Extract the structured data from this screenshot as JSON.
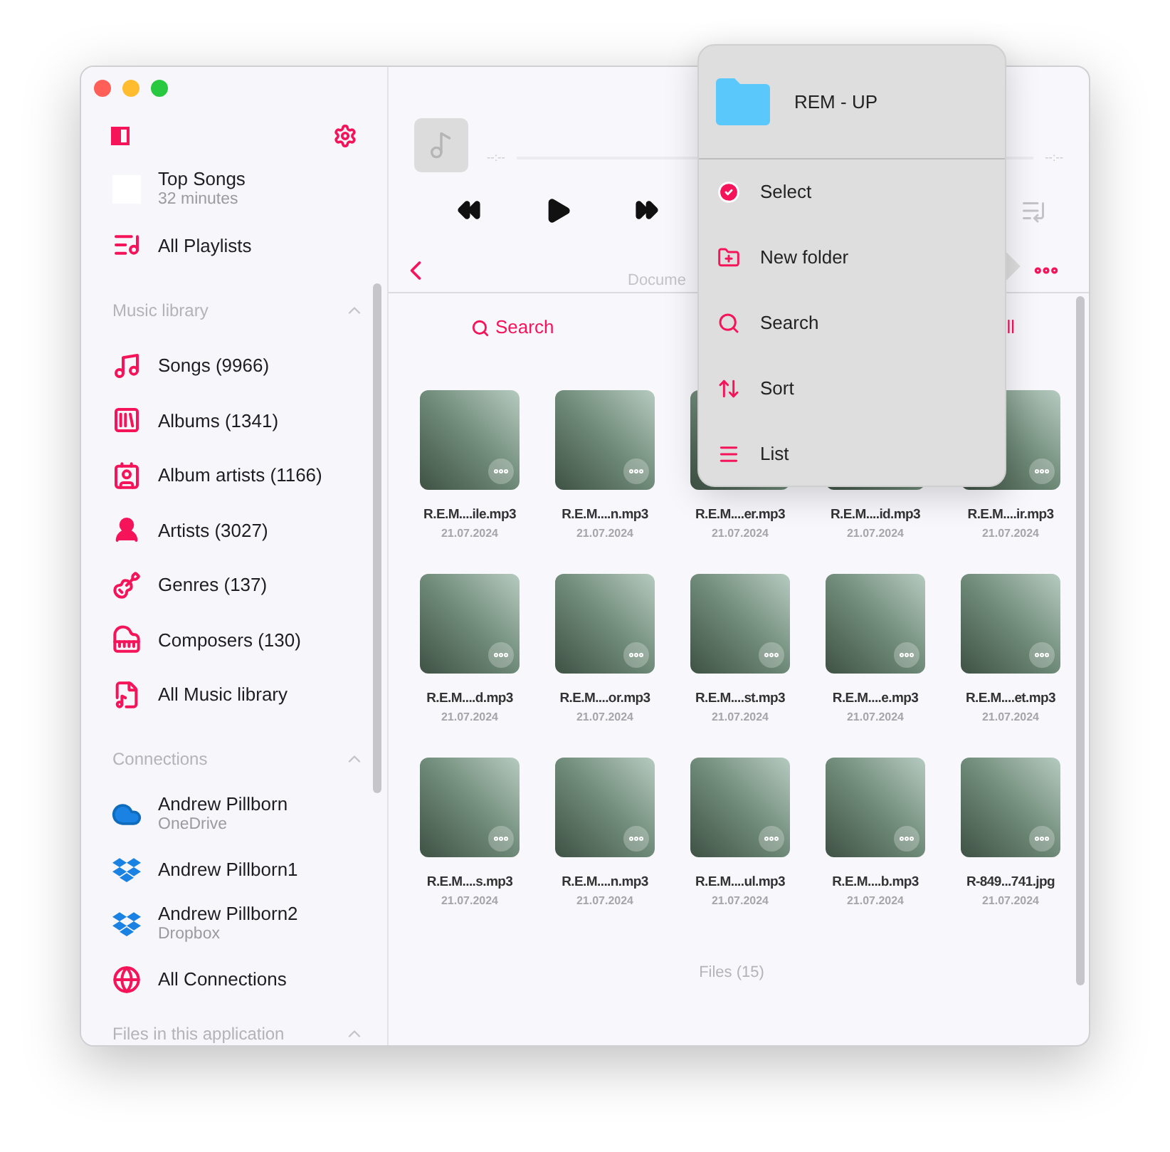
{
  "sidebar": {
    "top_items": [
      {
        "kind": "top_songs",
        "label": "Top Songs",
        "subtitle": "32 minutes"
      },
      {
        "kind": "playlists",
        "label": "All Playlists"
      }
    ],
    "sections": [
      {
        "title": "Music library",
        "expanded": true,
        "items": [
          {
            "kind": "songs",
            "label": "Songs (9966)"
          },
          {
            "kind": "albums",
            "label": "Albums (1341)"
          },
          {
            "kind": "album_artists",
            "label": "Album artists (1166)"
          },
          {
            "kind": "artists",
            "label": "Artists (3027)"
          },
          {
            "kind": "genres",
            "label": "Genres (137)"
          },
          {
            "kind": "composers",
            "label": "Composers (130)"
          },
          {
            "kind": "library",
            "label": "All Music library"
          }
        ]
      },
      {
        "title": "Connections",
        "expanded": true,
        "items": [
          {
            "kind": "onedrive",
            "label": "Andrew Pillborn",
            "subtitle": "OneDrive"
          },
          {
            "kind": "dropbox",
            "label": "Andrew Pillborn1"
          },
          {
            "kind": "dropbox",
            "label": "Andrew Pillborn2",
            "subtitle": "Dropbox"
          },
          {
            "kind": "globe",
            "label": "All Connections"
          }
        ]
      },
      {
        "title": "Files in this application",
        "expanded": true
      }
    ]
  },
  "player": {
    "elapsed": "--:--",
    "remaining": "--:--"
  },
  "nav": {
    "subtitle": "Docume"
  },
  "toolbar": {
    "search": "Search",
    "select_all": "ll"
  },
  "files": [
    {
      "name": "R.E.M....ile.mp3",
      "date": "21.07.2024"
    },
    {
      "name": "R.E.M....n.mp3",
      "date": "21.07.2024"
    },
    {
      "name": "R.E.M....er.mp3",
      "date": "21.07.2024"
    },
    {
      "name": "R.E.M....id.mp3",
      "date": "21.07.2024"
    },
    {
      "name": "R.E.M....ir.mp3",
      "date": "21.07.2024"
    },
    {
      "name": "R.E.M....d.mp3",
      "date": "21.07.2024"
    },
    {
      "name": "R.E.M....or.mp3",
      "date": "21.07.2024"
    },
    {
      "name": "R.E.M....st.mp3",
      "date": "21.07.2024"
    },
    {
      "name": "R.E.M....e.mp3",
      "date": "21.07.2024"
    },
    {
      "name": "R.E.M....et.mp3",
      "date": "21.07.2024"
    },
    {
      "name": "R.E.M....s.mp3",
      "date": "21.07.2024"
    },
    {
      "name": "R.E.M....n.mp3",
      "date": "21.07.2024"
    },
    {
      "name": "R.E.M....ul.mp3",
      "date": "21.07.2024"
    },
    {
      "name": "R.E.M....b.mp3",
      "date": "21.07.2024"
    },
    {
      "name": "R-849...741.jpg",
      "date": "21.07.2024"
    }
  ],
  "files_count": "Files (15)",
  "menu": {
    "title": "REM - UP",
    "items": [
      {
        "kind": "select",
        "label": "Select"
      },
      {
        "kind": "new_folder",
        "label": "New folder"
      },
      {
        "kind": "search",
        "label": "Search"
      },
      {
        "kind": "sort",
        "label": "Sort"
      },
      {
        "kind": "list",
        "label": "List"
      }
    ]
  }
}
